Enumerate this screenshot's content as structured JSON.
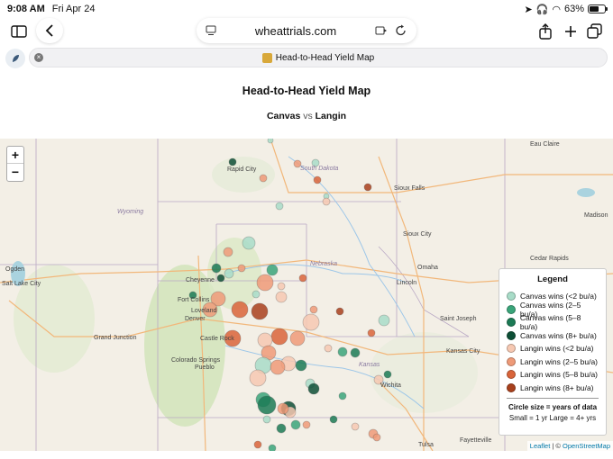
{
  "status": {
    "time": "9:08 AM",
    "date": "Fri Apr 24",
    "battery": "63%",
    "battery_level": 0.63
  },
  "browser": {
    "domain": "wheattrials.com",
    "tab_title": "Head-to-Head Yield Map"
  },
  "page": {
    "title": "Head-to-Head Yield Map",
    "variety_a": "Canvas",
    "vs": "vs",
    "variety_b": "Langin"
  },
  "map": {
    "zoom_in": "+",
    "zoom_out": "−",
    "labels": [
      "Rapid City",
      "South Dakota",
      "Sioux Falls",
      "Wyoming",
      "Sioux City",
      "Nebraska",
      "Omaha",
      "Lincoln",
      "Cheyenne",
      "Fort Collins",
      "Loveland",
      "Denver",
      "Castle Rock",
      "Grand Junction",
      "Colorado Springs",
      "Pueblo",
      "Kansas",
      "Wichita",
      "Kansas City",
      "Saint Joseph",
      "Ogden",
      "Salt Lake City",
      "Eau Claire",
      "Madison",
      "Cedar Rapids",
      "Tulsa",
      "Fayetteville"
    ],
    "attribution": {
      "leaflet": "Leaflet",
      "sep": " | © ",
      "osm": "OpenStreetMap"
    }
  },
  "legend": {
    "title": "Legend",
    "items": [
      {
        "label": "Canvas wins (<2 bu/a)",
        "color": "#a8dcc8"
      },
      {
        "label": "Canvas wins (2–5 bu/a)",
        "color": "#3aa57a"
      },
      {
        "label": "Canvas wins (5–8 bu/a)",
        "color": "#1b7a55"
      },
      {
        "label": "Canvas wins (8+ bu/a)",
        "color": "#0d4f36"
      },
      {
        "label": "Langin wins (<2 bu/a)",
        "color": "#f6c8b2"
      },
      {
        "label": "Langin wins (2–5 bu/a)",
        "color": "#ee9a78"
      },
      {
        "label": "Langin wins (5–8 bu/a)",
        "color": "#d9643a"
      },
      {
        "label": "Langin wins (8+ bu/a)",
        "color": "#a8401c"
      }
    ],
    "size_title": "Circle size = years of data",
    "size_scale": "Small = 1 yr   Large = 4+ yrs"
  }
}
